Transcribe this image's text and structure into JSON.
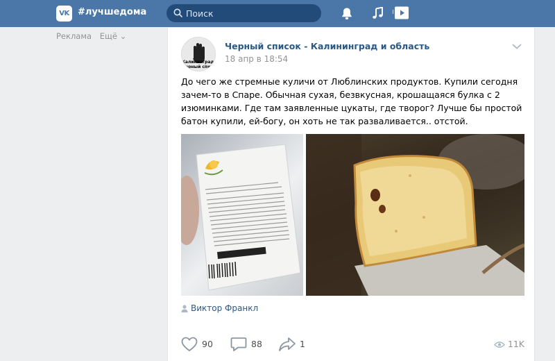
{
  "topbar": {
    "logo_text": "VK",
    "brand": "#лучшедома",
    "search_placeholder": "Поиск",
    "icons": [
      "bell-icon",
      "music-icon",
      "play-icon"
    ],
    "background_color": "#4a76a8"
  },
  "leftnav": {
    "ads_label": "Реклама",
    "more_label": "Ещё ⌄"
  },
  "post": {
    "group_name": "Черный список - Калининград и область",
    "avatar_text": "Калининградски\nчерный списо",
    "time": "18 апр в 18:54",
    "text": "До чего же стремные куличи от Люблинских продуктов. Купили сегодня зачем-то в Спаре. Обычная сухая, безвкусная, крошащаяся булка с 2 изюминками. Где там заявленные цукаты, где творог? Лучше бы простой батон купили, ей-богу, он хоть не так разваливается.. отстой.",
    "photo_label": "Люблинские продукты",
    "photo_footer": "Изготовитель: ООО «Фабрика «Люблинские продукты»",
    "author": "Виктор Франкл",
    "likes": "90",
    "comments": "88",
    "shares": "1",
    "views": "11K",
    "link_color": "#2a5885"
  }
}
